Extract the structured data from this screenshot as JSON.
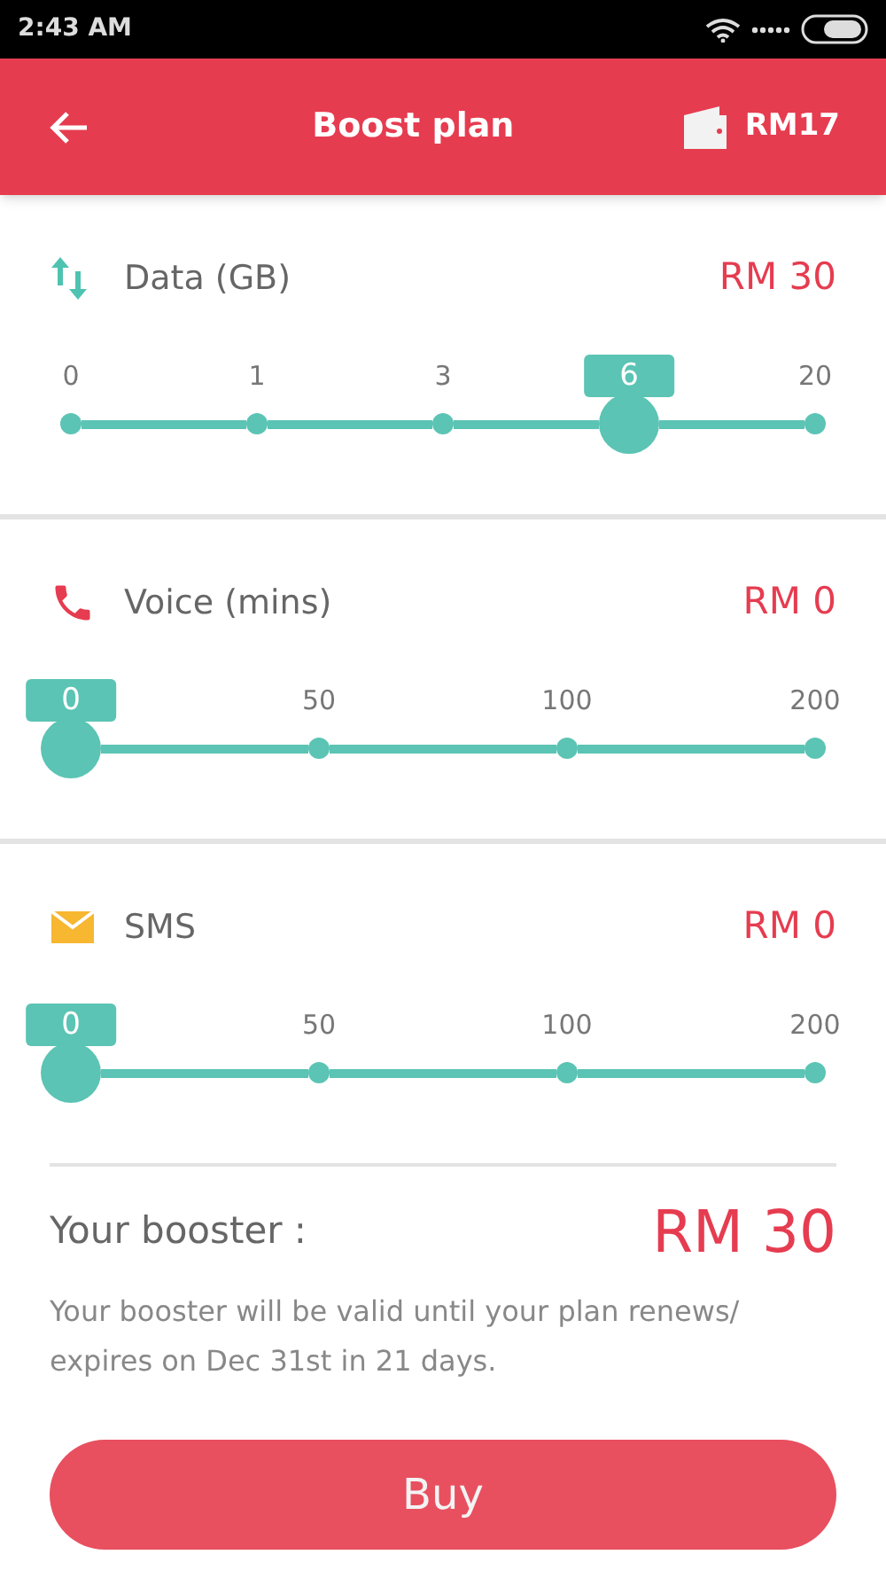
{
  "status_bar": {
    "time": "2:43 AM"
  },
  "header": {
    "title": "Boost plan",
    "balance": "RM17"
  },
  "sections": [
    {
      "kind": "data",
      "label": "Data (GB)",
      "price": "RM 30",
      "level": 0.75,
      "ticks": [
        {
          "label": "0",
          "selected": false
        },
        {
          "label": "1",
          "selected": false
        },
        {
          "label": "3",
          "selected": false
        },
        {
          "label": "6",
          "selected": true
        },
        {
          "label": "20",
          "selected": false
        }
      ]
    },
    {
      "kind": "voice",
      "label": "Voice (mins)",
      "price": "RM 0",
      "level": 0,
      "ticks": [
        {
          "label": "0",
          "selected": true
        },
        {
          "label": "50",
          "selected": false
        },
        {
          "label": "100",
          "selected": false
        },
        {
          "label": "200",
          "selected": false
        }
      ]
    },
    {
      "kind": "sms",
      "label": "SMS",
      "price": "RM 0",
      "level": 0,
      "ticks": [
        {
          "label": "0",
          "selected": true
        },
        {
          "label": "50",
          "selected": false
        },
        {
          "label": "100",
          "selected": false
        },
        {
          "label": "200",
          "selected": false
        }
      ]
    }
  ],
  "summary": {
    "label": "Your booster :",
    "total": "RM 30",
    "note": "Your booster will be valid until your plan renews/ expires on Dec 31st in 21 days."
  },
  "buy_button": "Buy"
}
